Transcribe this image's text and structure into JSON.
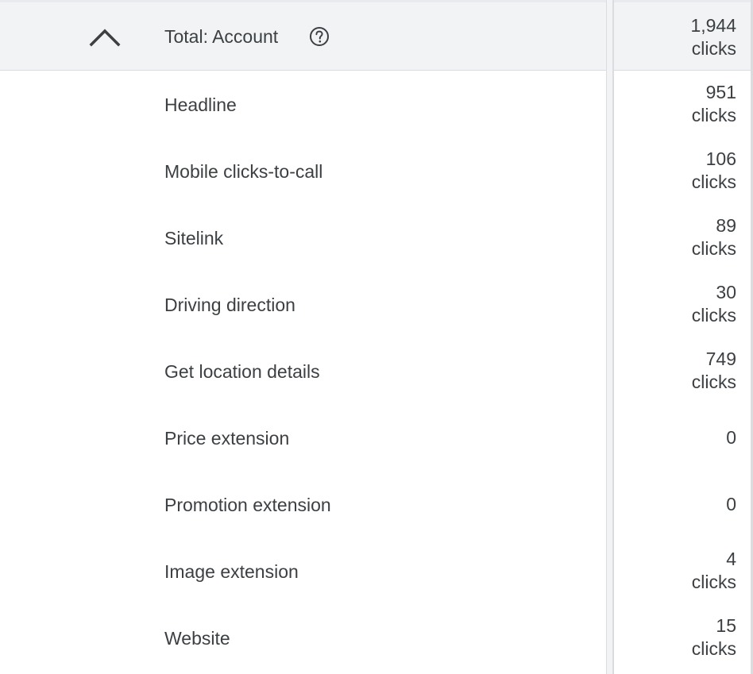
{
  "total": {
    "label": "Total: Account",
    "value": "1,944",
    "unit": "clicks"
  },
  "rows": [
    {
      "label": "Headline",
      "value": "951",
      "unit": "clicks"
    },
    {
      "label": "Mobile clicks-to-call",
      "value": "106",
      "unit": "clicks"
    },
    {
      "label": "Sitelink",
      "value": "89",
      "unit": "clicks"
    },
    {
      "label": "Driving direction",
      "value": "30",
      "unit": "clicks"
    },
    {
      "label": "Get location details",
      "value": "749",
      "unit": "clicks"
    },
    {
      "label": "Price extension",
      "value": "0",
      "unit": ""
    },
    {
      "label": "Promotion extension",
      "value": "0",
      "unit": ""
    },
    {
      "label": "Image extension",
      "value": "4",
      "unit": "clicks"
    },
    {
      "label": "Website",
      "value": "15",
      "unit": "clicks"
    }
  ],
  "icons": {
    "collapse": "chevron-up-icon",
    "help": "help-circle-icon"
  },
  "colors": {
    "text": "#3c4043",
    "total_row_bg": "#f1f3f4",
    "divider": "#dadce0"
  }
}
